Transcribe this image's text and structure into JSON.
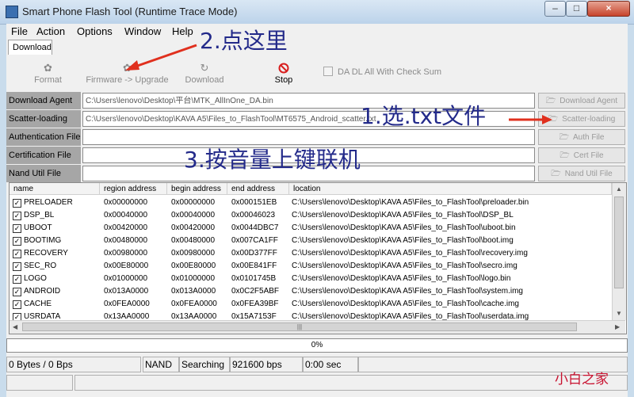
{
  "window": {
    "title": "Smart Phone Flash Tool (Runtime Trace Mode)",
    "minimize": "–",
    "maximize": "□",
    "close": "×"
  },
  "menu": [
    "File",
    "Action",
    "Options",
    "Window",
    "Help"
  ],
  "tabs": [
    "Download"
  ],
  "toolbar": {
    "format": "Format",
    "firmware_upgrade": "Firmware -> Upgrade",
    "download": "Download",
    "stop": "Stop",
    "checksum": "DA DL All With Check Sum"
  },
  "fields": [
    {
      "label": "Download Agent",
      "value": "C:\\Users\\lenovo\\Desktop\\平台\\MTK_AllInOne_DA.bin",
      "button": "Download Agent"
    },
    {
      "label": "Scatter-loading File",
      "value": "C:\\Users\\lenovo\\Desktop\\KAVA A5\\Files_to_FlashTool\\MT6575_Android_scatter.txt",
      "button": "Scatter-loading"
    },
    {
      "label": "Authentication File",
      "value": "",
      "button": "Auth File"
    },
    {
      "label": "Certification File",
      "value": "",
      "button": "Cert File"
    },
    {
      "label": "Nand Util File",
      "value": "",
      "button": "Nand Util File"
    }
  ],
  "table": {
    "columns": [
      "name",
      "region address",
      "begin address",
      "end address",
      "location"
    ],
    "rows": [
      {
        "name": "PRELOADER",
        "region": "0x00000000",
        "begin": "0x00000000",
        "end": "0x000151EB",
        "location": "C:\\Users\\lenovo\\Desktop\\KAVA A5\\Files_to_FlashTool\\preloader.bin"
      },
      {
        "name": "DSP_BL",
        "region": "0x00040000",
        "begin": "0x00040000",
        "end": "0x00046023",
        "location": "C:\\Users\\lenovo\\Desktop\\KAVA A5\\Files_to_FlashTool\\DSP_BL"
      },
      {
        "name": "UBOOT",
        "region": "0x00420000",
        "begin": "0x00420000",
        "end": "0x0044DBC7",
        "location": "C:\\Users\\lenovo\\Desktop\\KAVA A5\\Files_to_FlashTool\\uboot.bin"
      },
      {
        "name": "BOOTIMG",
        "region": "0x00480000",
        "begin": "0x00480000",
        "end": "0x007CA1FF",
        "location": "C:\\Users\\lenovo\\Desktop\\KAVA A5\\Files_to_FlashTool\\boot.img"
      },
      {
        "name": "RECOVERY",
        "region": "0x00980000",
        "begin": "0x00980000",
        "end": "0x00D377FF",
        "location": "C:\\Users\\lenovo\\Desktop\\KAVA A5\\Files_to_FlashTool\\recovery.img"
      },
      {
        "name": "SEC_RO",
        "region": "0x00E80000",
        "begin": "0x00E80000",
        "end": "0x00E841FF",
        "location": "C:\\Users\\lenovo\\Desktop\\KAVA A5\\Files_to_FlashTool\\secro.img"
      },
      {
        "name": "LOGO",
        "region": "0x01000000",
        "begin": "0x01000000",
        "end": "0x0101745B",
        "location": "C:\\Users\\lenovo\\Desktop\\KAVA A5\\Files_to_FlashTool\\logo.bin"
      },
      {
        "name": "ANDROID",
        "region": "0x013A0000",
        "begin": "0x013A0000",
        "end": "0x0C2F5ABF",
        "location": "C:\\Users\\lenovo\\Desktop\\KAVA A5\\Files_to_FlashTool\\system.img"
      },
      {
        "name": "CACHE",
        "region": "0x0FEA0000",
        "begin": "0x0FEA0000",
        "end": "0x0FEA39BF",
        "location": "C:\\Users\\lenovo\\Desktop\\KAVA A5\\Files_to_FlashTool\\cache.img"
      },
      {
        "name": "USRDATA",
        "region": "0x13AA0000",
        "begin": "0x13AA0000",
        "end": "0x15A7153F",
        "location": "C:\\Users\\lenovo\\Desktop\\KAVA A5\\Files_to_FlashTool\\userdata.img"
      }
    ]
  },
  "progress": {
    "text": "0%",
    "value": 0
  },
  "status": {
    "bytes": "0 Bytes / 0 Bps",
    "storage": "NAND",
    "state": "Searching",
    "baud": "921600 bps",
    "time": "0:00 sec"
  },
  "annotations": {
    "step1": "1.选.txt文件",
    "step2": "2.点这里",
    "step3": "3.按音量上键联机",
    "watermark": "小白之家"
  },
  "colors": {
    "annotation": "#232a8a",
    "arrow": "#e0301e",
    "watermark": "#c8102e"
  }
}
